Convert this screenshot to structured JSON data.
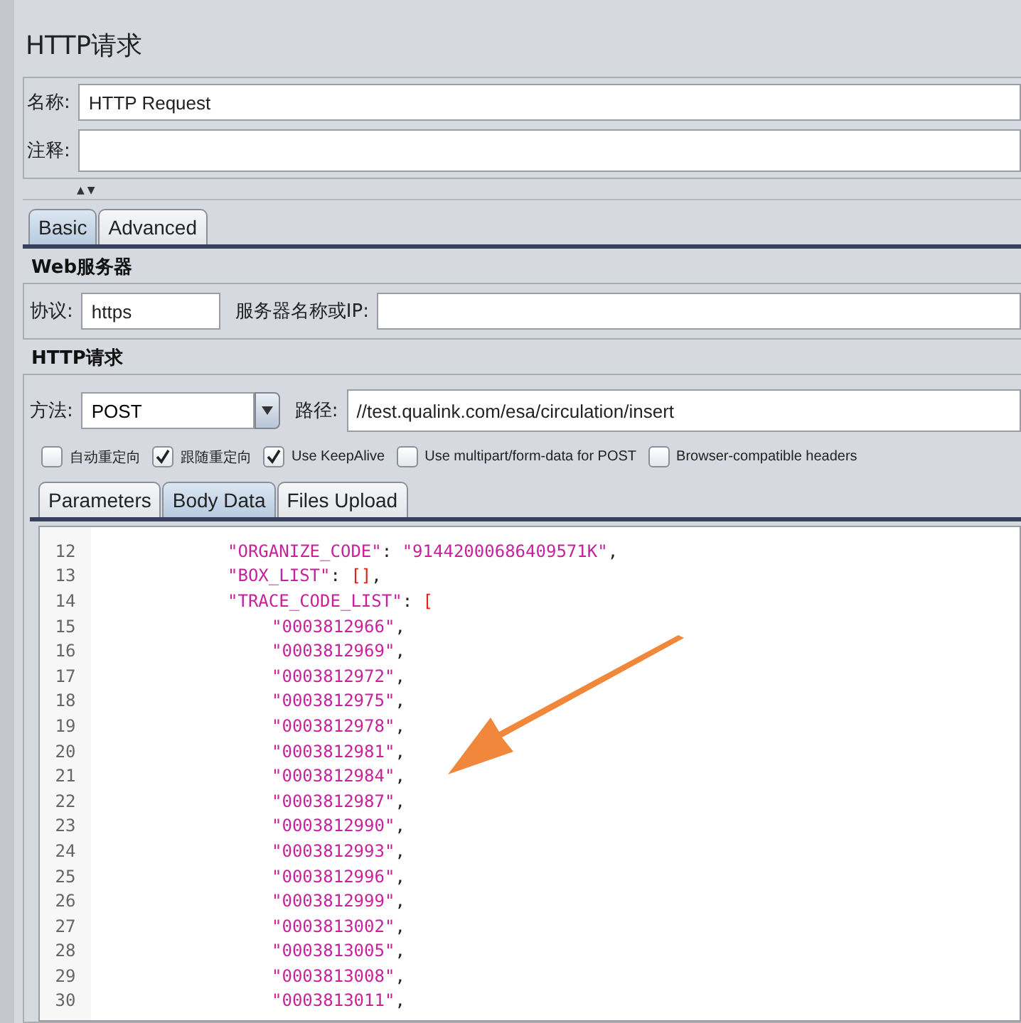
{
  "title": "HTTP请求",
  "name_field": {
    "label": "名称:",
    "value": "HTTP Request"
  },
  "comment_field": {
    "label": "注释:"
  },
  "splitter": {
    "arrows": "▲▼"
  },
  "tabs": [
    {
      "label": "Basic",
      "selected": true
    },
    {
      "label": "Advanced",
      "selected": false
    }
  ],
  "web_server": {
    "heading": "Web服务器",
    "protocol_label": "协议:",
    "protocol": "https",
    "server_label": "服务器名称或IP:"
  },
  "http_request": {
    "heading": "HTTP请求",
    "method_label": "方法:",
    "method": "POST",
    "path_label": "路径:",
    "path": "//test.qualink.com/esa/circulation/insert"
  },
  "options": [
    {
      "label": "自动重定向",
      "checked": false
    },
    {
      "label": "跟随重定向",
      "checked": true
    },
    {
      "label": "Use KeepAlive",
      "checked": true
    },
    {
      "label": "Use multipart/form-data for POST",
      "checked": false
    },
    {
      "label": "Browser-compatible headers",
      "checked": false
    }
  ],
  "body_tabs": [
    {
      "label": "Parameters",
      "selected": false
    },
    {
      "label": "Body Data",
      "selected": true
    },
    {
      "label": "Files Upload",
      "selected": false
    }
  ],
  "code_lines": [
    {
      "number": "12",
      "tokens": [
        {
          "kind": "string",
          "text": "\"ORGANIZE_CODE\""
        },
        {
          "kind": "plain",
          "text": ": "
        },
        {
          "kind": "string",
          "text": "\"91442000686409571K\""
        },
        {
          "kind": "plain",
          "text": ","
        }
      ]
    },
    {
      "number": "13",
      "tokens": [
        {
          "kind": "string",
          "text": "\"BOX_LIST\""
        },
        {
          "kind": "plain",
          "text": ": "
        },
        {
          "kind": "bracket",
          "text": "[]"
        },
        {
          "kind": "plain",
          "text": ","
        }
      ]
    },
    {
      "number": "14",
      "tokens": [
        {
          "kind": "string",
          "text": "\"TRACE_CODE_LIST\""
        },
        {
          "kind": "plain",
          "text": ": "
        },
        {
          "kind": "bracket",
          "text": "["
        }
      ],
      "children": [
        {
          "number": "15",
          "tokens": [
            {
              "kind": "string",
              "text": "\"0003812966\""
            },
            {
              "kind": "plain",
              "text": ","
            }
          ]
        },
        {
          "number": "16",
          "tokens": [
            {
              "kind": "string",
              "text": "\"0003812969\""
            },
            {
              "kind": "plain",
              "text": ","
            }
          ]
        },
        {
          "number": "17",
          "tokens": [
            {
              "kind": "string",
              "text": "\"0003812972\""
            },
            {
              "kind": "plain",
              "text": ","
            }
          ]
        },
        {
          "number": "18",
          "tokens": [
            {
              "kind": "string",
              "text": "\"0003812975\""
            },
            {
              "kind": "plain",
              "text": ","
            }
          ]
        },
        {
          "number": "19",
          "tokens": [
            {
              "kind": "string",
              "text": "\"0003812978\""
            },
            {
              "kind": "plain",
              "text": ","
            }
          ]
        },
        {
          "number": "20",
          "tokens": [
            {
              "kind": "string",
              "text": "\"0003812981\""
            },
            {
              "kind": "plain",
              "text": ","
            }
          ]
        },
        {
          "number": "21",
          "tokens": [
            {
              "kind": "string",
              "text": "\"0003812984\""
            },
            {
              "kind": "plain",
              "text": ","
            }
          ]
        },
        {
          "number": "22",
          "tokens": [
            {
              "kind": "string",
              "text": "\"0003812987\""
            },
            {
              "kind": "plain",
              "text": ","
            }
          ]
        },
        {
          "number": "23",
          "tokens": [
            {
              "kind": "string",
              "text": "\"0003812990\""
            },
            {
              "kind": "plain",
              "text": ","
            }
          ]
        },
        {
          "number": "24",
          "tokens": [
            {
              "kind": "string",
              "text": "\"0003812993\""
            },
            {
              "kind": "plain",
              "text": ","
            }
          ]
        },
        {
          "number": "25",
          "tokens": [
            {
              "kind": "string",
              "text": "\"0003812996\""
            },
            {
              "kind": "plain",
              "text": ","
            }
          ]
        },
        {
          "number": "26",
          "tokens": [
            {
              "kind": "string",
              "text": "\"0003812999\""
            },
            {
              "kind": "plain",
              "text": ","
            }
          ]
        },
        {
          "number": "27",
          "tokens": [
            {
              "kind": "string",
              "text": "\"0003813002\""
            },
            {
              "kind": "plain",
              "text": ","
            }
          ]
        },
        {
          "number": "28",
          "tokens": [
            {
              "kind": "string",
              "text": "\"0003813005\""
            },
            {
              "kind": "plain",
              "text": ","
            }
          ]
        },
        {
          "number": "29",
          "tokens": [
            {
              "kind": "string",
              "text": "\"0003813008\""
            },
            {
              "kind": "plain",
              "text": ","
            }
          ]
        },
        {
          "number": "30",
          "tokens": [
            {
              "kind": "string",
              "text": "\"0003813011\""
            },
            {
              "kind": "plain",
              "text": ","
            }
          ]
        }
      ]
    }
  ]
}
